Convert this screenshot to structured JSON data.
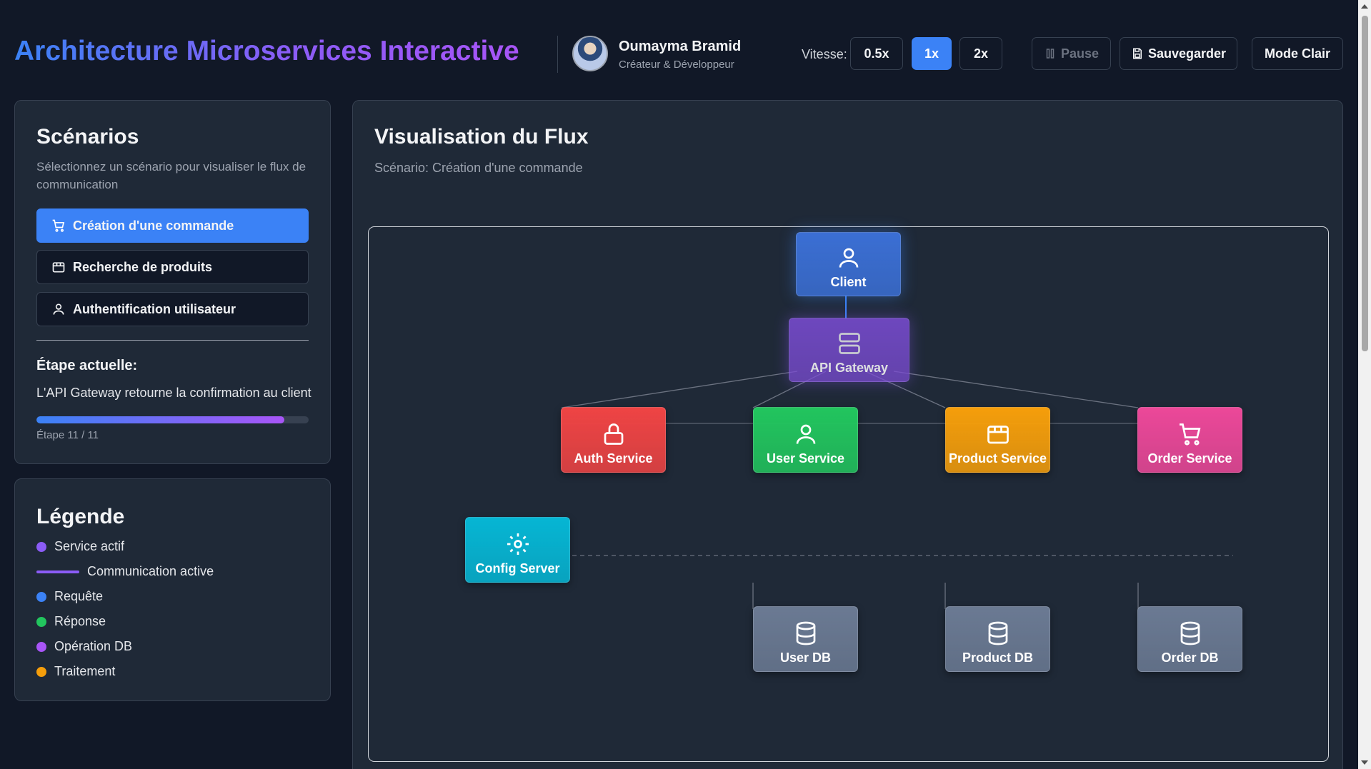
{
  "header": {
    "title": "Architecture Microservices Interactive",
    "user_name": "Oumayma Bramid",
    "user_role": "Créateur & Développeur",
    "speed_label": "Vitesse:",
    "speeds": [
      "0.5x",
      "1x",
      "2x"
    ],
    "active_speed": "1x",
    "pause_label": "Pause",
    "save_label": "Sauvegarder",
    "theme_label": "Mode Clair"
  },
  "scenarios": {
    "title": "Scénarios",
    "description": "Sélectionnez un scénario pour visualiser le flux de communication",
    "items": [
      {
        "label": "Création d'une commande",
        "icon": "cart-icon",
        "active": true
      },
      {
        "label": "Recherche de produits",
        "icon": "box-icon",
        "active": false
      },
      {
        "label": "Authentification utilisateur",
        "icon": "user-icon",
        "active": false
      }
    ],
    "current_step_title": "Étape actuelle:",
    "current_step_text": "L'API Gateway retourne la confirmation au client",
    "progress_fraction": 0.91,
    "step_count": "Étape 11 / 11"
  },
  "legend": {
    "title": "Légende",
    "items": [
      {
        "label": "Service actif",
        "kind": "dot",
        "color": "#8b5cf6"
      },
      {
        "label": "Communication active",
        "kind": "line",
        "color": "#8b5cf6"
      },
      {
        "label": "Requête",
        "kind": "dot",
        "color": "#3b82f6"
      },
      {
        "label": "Réponse",
        "kind": "dot",
        "color": "#22c55e"
      },
      {
        "label": "Opération DB",
        "kind": "dot",
        "color": "#a855f7"
      },
      {
        "label": "Traitement",
        "kind": "dot",
        "color": "#f59e0b"
      }
    ]
  },
  "flow": {
    "title": "Visualisation du Flux",
    "subtitle": "Scénario: Création d'une commande",
    "nodes": {
      "client": {
        "label": "Client",
        "icon": "user-icon",
        "color": "#3b6fd4"
      },
      "gateway": {
        "label": "API Gateway",
        "icon": "server-icon",
        "color": "#7c4dd6"
      },
      "auth": {
        "label": "Auth Service",
        "icon": "lock-icon",
        "color": "#ef4444"
      },
      "user": {
        "label": "User Service",
        "icon": "user-icon",
        "color": "#22c55e"
      },
      "product": {
        "label": "Product Service",
        "icon": "box-icon",
        "color": "#f59e0b"
      },
      "order": {
        "label": "Order Service",
        "icon": "cart-icon",
        "color": "#ec4899"
      },
      "config": {
        "label": "Config Server",
        "icon": "gear-icon",
        "color": "#06b6d4"
      },
      "userdb": {
        "label": "User DB",
        "icon": "database-icon",
        "color": "#6b7a93"
      },
      "productdb": {
        "label": "Product DB",
        "icon": "database-icon",
        "color": "#6b7a93"
      },
      "orderdb": {
        "label": "Order DB",
        "icon": "database-icon",
        "color": "#6b7a93"
      }
    }
  }
}
